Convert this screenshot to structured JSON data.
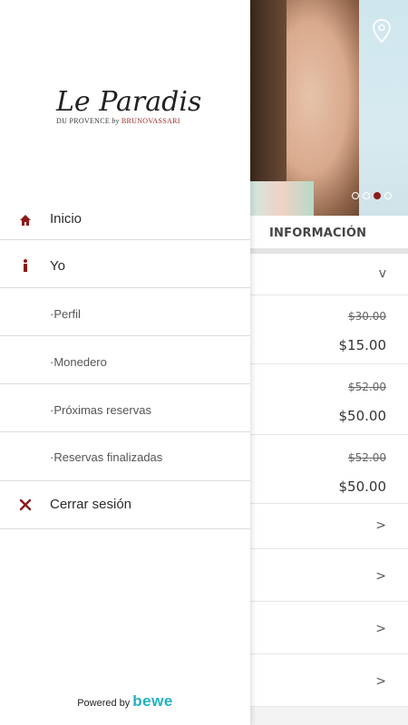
{
  "drawer": {
    "logo": {
      "title": "Le Paradis",
      "subtitle_left": "DU PROVENCE",
      "subtitle_by": "by",
      "subtitle_brand": "BRUNOVASSARI"
    },
    "items": [
      {
        "label": "Inicio",
        "icon": "home-icon"
      },
      {
        "label": "Yo",
        "icon": "person-icon"
      },
      {
        "label": "·Perfil"
      },
      {
        "label": "·Monedero"
      },
      {
        "label": "·Próximas reservas"
      },
      {
        "label": "·Reservas finalizadas"
      },
      {
        "label": "Cerrar sesión",
        "icon": "close-icon"
      }
    ],
    "powered_by": {
      "text": "Powered by",
      "brand": "bewe"
    }
  },
  "background": {
    "info_tab": "INFORMACIÓN",
    "prices": [
      {
        "old": "$30.00",
        "new": "$15.00"
      },
      {
        "old": "$52.00",
        "new": "$50.00"
      },
      {
        "old": "$52.00",
        "new": "$50.00"
      }
    ],
    "dropdown_chevron": "v",
    "row_chevron": ">"
  },
  "colors": {
    "accent": "#8b1b1b",
    "brand": "#1eb3c0"
  }
}
